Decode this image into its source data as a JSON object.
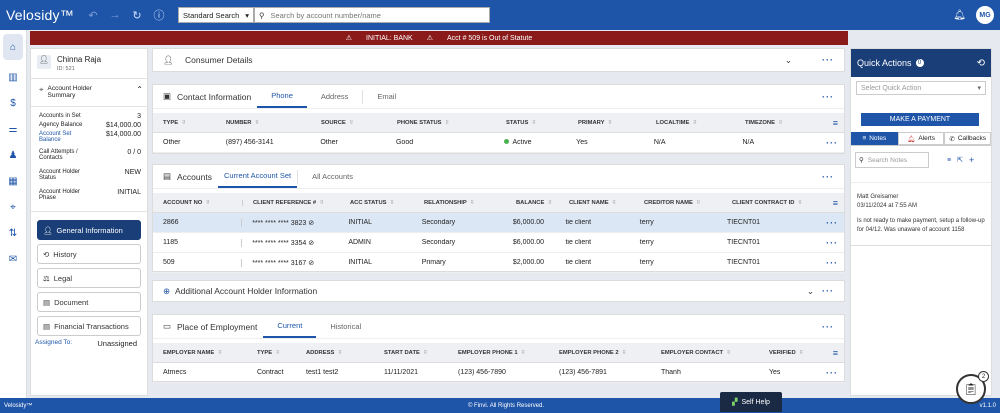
{
  "app": {
    "brand": "Velosidy™",
    "footer_brand": "Velosidy™",
    "copyright": "© Finvi. All Rights Reserved.",
    "version": "v1.1.0",
    "self_help": "Self Help"
  },
  "search": {
    "type": "Standard Search",
    "placeholder": "Search by account number/name"
  },
  "user": {
    "initials": "MG"
  },
  "banner": {
    "msg1": "INITIAL: BANK",
    "msg2": "Acct # 509 is Out of Statute"
  },
  "sidepanel": {
    "name": "Chinna Raja",
    "id": "ID: 521",
    "summary_title": "Account Holder Summary",
    "rows": [
      {
        "label": "Accounts in Set",
        "value": "3"
      },
      {
        "label": "Agency Balance",
        "value": "$14,000.00"
      },
      {
        "label": "Account Set Balance",
        "value": "$14,000.00"
      },
      {
        "label": "Call Attempts / Contacts",
        "value": "0 / 0"
      },
      {
        "label": "Account Holder Status",
        "value": "NEW"
      },
      {
        "label": "Account Holder Phase",
        "value": "INITIAL"
      }
    ],
    "buttons": [
      {
        "label": "General Information"
      },
      {
        "label": "History"
      },
      {
        "label": "Legal"
      },
      {
        "label": "Document"
      },
      {
        "label": "Financial Transactions"
      }
    ],
    "assigned_label": "Assigned To:",
    "assigned_value": "Unassigned"
  },
  "consumer": {
    "title": "Consumer Details"
  },
  "contact": {
    "title": "Contact Information",
    "tabs": [
      "Phone",
      "Address",
      "Email"
    ],
    "headers": [
      "TYPE",
      "NUMBER",
      "SOURCE",
      "PHONE STATUS",
      "STATUS",
      "PRIMARY",
      "LOCALTIME",
      "TIMEZONE"
    ],
    "row": {
      "type": "Other",
      "number": "(897) 456-3141",
      "source": "Other",
      "phone_status": "Good",
      "status": "Active",
      "primary": "Yes",
      "localtime": "N/A",
      "timezone": "N/A"
    }
  },
  "accounts": {
    "title": "Accounts",
    "tabs": [
      "Current Account Set",
      "All Accounts"
    ],
    "headers": [
      "ACCOUNT NO",
      "CLIENT REFERENCE #",
      "ACC STATUS",
      "RELATIONSHIP",
      "BALANCE",
      "CLIENT NAME",
      "CREDITOR NAME",
      "CLIENT CONTRACT ID"
    ],
    "rows": [
      {
        "no": "2866",
        "ref": "**** **** **** 3823",
        "status": "INITIAL",
        "rel": "Secondary",
        "bal": "$6,000.00",
        "client": "tie client",
        "creditor": "terry",
        "contract": "TIECNT01"
      },
      {
        "no": "1185",
        "ref": "**** **** **** 3354",
        "status": "ADMIN",
        "rel": "Secondary",
        "bal": "$6,000.00",
        "client": "tie client",
        "creditor": "terry",
        "contract": "TIECNT01"
      },
      {
        "no": "509",
        "ref": "**** **** **** 3167",
        "status": "INITIAL",
        "rel": "Primary",
        "bal": "$2,000.00",
        "client": "tie client",
        "creditor": "terry",
        "contract": "TIECNT01"
      }
    ]
  },
  "additional": {
    "title": "Additional Account Holder Information"
  },
  "employment": {
    "title": "Place of Employment",
    "tabs": [
      "Current",
      "Historical"
    ],
    "headers": [
      "EMPLOYER NAME",
      "TYPE",
      "ADDRESS",
      "START DATE",
      "EMPLOYER PHONE 1",
      "EMPLOYER PHONE 2",
      "EMPLOYER CONTACT",
      "VERIFIED"
    ],
    "row": {
      "name": "Atmecs",
      "type": "Contract",
      "address": "test1 test2",
      "start": "11/11/2021",
      "phone1": "(123) 456-7890",
      "phone2": "(123) 456-7891",
      "contact": "Thanh",
      "verified": "Yes"
    }
  },
  "quick": {
    "title": "Quick Actions",
    "count": "0",
    "select_placeholder": "Select Quick Action",
    "pay_label": "MAKE A PAYMENT",
    "tabs": [
      "Notes",
      "Alerts",
      "Callbacks"
    ],
    "search_placeholder": "Search Notes",
    "note": {
      "author": "Matt Greisamer",
      "date": "03/11/2024 at 7:55 AM",
      "text": "Is not ready to make payment, setup a follow-up for 04/12. Was unaware of account 1158"
    }
  },
  "fab_badge": "2"
}
